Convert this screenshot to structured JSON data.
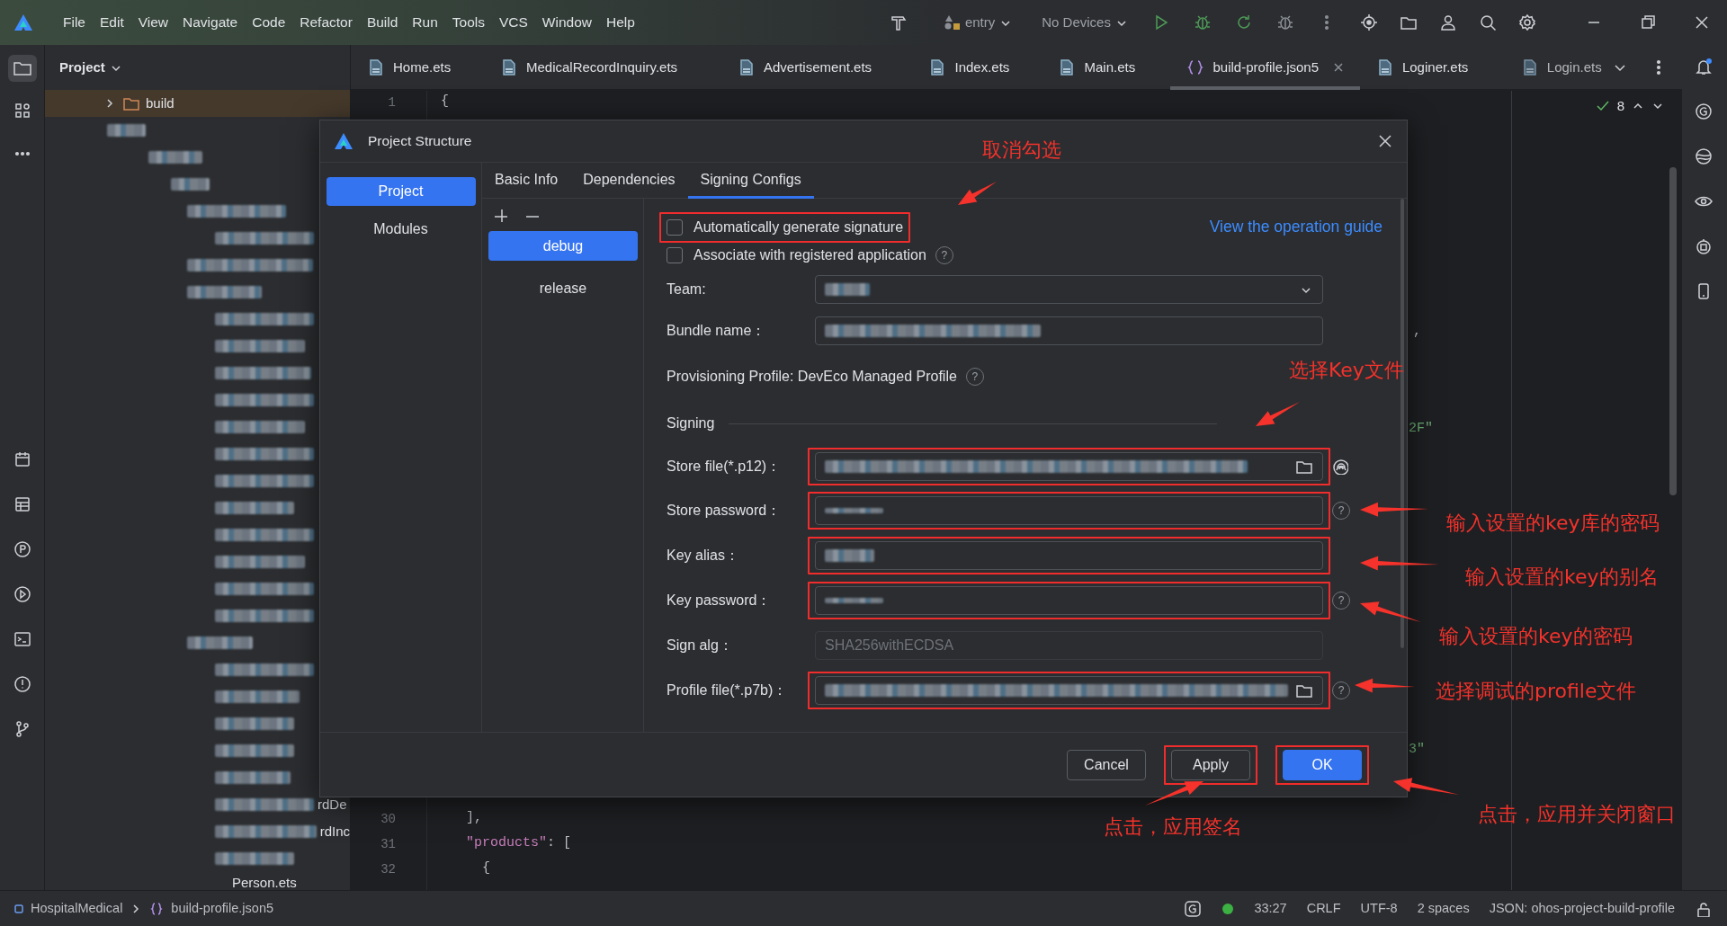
{
  "menu": [
    "File",
    "Edit",
    "View",
    "Navigate",
    "Code",
    "Refactor",
    "Build",
    "Run",
    "Tools",
    "VCS",
    "Window",
    "Help"
  ],
  "toolbar": {
    "run_config": "entry",
    "device": "No Devices"
  },
  "project_panel": {
    "title": "Project",
    "root": "build",
    "fragments": [
      "rdDe",
      "rdInc"
    ],
    "last_item": "Person.ets"
  },
  "editor_tabs": [
    {
      "label": "Home.ets",
      "kind": "ets",
      "selected": false
    },
    {
      "label": "MedicalRecordInquiry.ets",
      "kind": "ets",
      "selected": false
    },
    {
      "label": "Advertisement.ets",
      "kind": "ets",
      "selected": false
    },
    {
      "label": "Index.ets",
      "kind": "ets",
      "selected": false
    },
    {
      "label": "Main.ets",
      "kind": "ets",
      "selected": false
    },
    {
      "label": "build-profile.json5",
      "kind": "json",
      "selected": true
    },
    {
      "label": "Loginer.ets",
      "kind": "ets",
      "selected": false
    },
    {
      "label": "Login.ets",
      "kind": "ets",
      "selected": false
    }
  ],
  "inspections": {
    "count": "8"
  },
  "code_lines": [
    {
      "number": "1",
      "tokens": [
        {
          "text": "{",
          "kind": "punct"
        }
      ]
    },
    {
      "number": "30",
      "tokens": [
        {
          "text": "],",
          "kind": "punct"
        }
      ]
    },
    {
      "number": "31",
      "tokens": [
        {
          "text": "\"products\"",
          "kind": "key"
        },
        {
          "text": ": [",
          "kind": "punct"
        }
      ]
    },
    {
      "number": "32",
      "tokens": [
        {
          "text": "{",
          "kind": "punct"
        }
      ]
    }
  ],
  "code_fragments": [
    ",",
    "2F\"",
    "3\""
  ],
  "dialog": {
    "title": "Project Structure",
    "nav": [
      {
        "label": "Project",
        "selected": true
      },
      {
        "label": "Modules",
        "selected": false
      }
    ],
    "tabs": [
      {
        "label": "Basic Info",
        "selected": false
      },
      {
        "label": "Dependencies",
        "selected": false
      },
      {
        "label": "Signing Configs",
        "selected": true
      }
    ],
    "configs": [
      {
        "label": "debug",
        "selected": true
      },
      {
        "label": "release",
        "selected": false
      }
    ],
    "options": [
      {
        "label": "Automatically generate signature",
        "checked": false,
        "highlighted": true
      },
      {
        "label": "Associate with registered application",
        "checked": false,
        "highlighted": false,
        "help": "?"
      }
    ],
    "guide_link": "View the operation guide",
    "fields": [
      {
        "kind": "select",
        "label": "Team:",
        "blurred": true,
        "highlighted": false
      },
      {
        "kind": "text",
        "label": "Bundle name：",
        "blurred": true,
        "highlighted": false
      },
      {
        "kind": "info",
        "label": "Provisioning Profile: DevEco Managed Profile",
        "help": "?"
      },
      {
        "kind": "section",
        "label": "Signing"
      },
      {
        "kind": "keystore",
        "label": "Store file(*.p12)：",
        "blurred": true,
        "highlighted": true
      },
      {
        "kind": "password",
        "label": "Store password：",
        "blurred": true,
        "highlighted": true,
        "help": "?"
      },
      {
        "kind": "text",
        "label": "Key alias：",
        "blurred": true,
        "highlighted": true
      },
      {
        "kind": "password",
        "label": "Key password：",
        "blurred": true,
        "highlighted": true,
        "help": "?"
      },
      {
        "kind": "readonly",
        "label": "Sign alg：",
        "value": "SHA256withECDSA",
        "highlighted": false
      },
      {
        "kind": "file",
        "label": "Profile file(*.p7b)：",
        "blurred": true,
        "highlighted": true,
        "help": "?"
      }
    ],
    "buttons": [
      {
        "label": "Cancel",
        "kind": "secondary",
        "highlighted": false
      },
      {
        "label": "Apply",
        "kind": "secondary",
        "highlighted": true
      },
      {
        "label": "OK",
        "kind": "primary",
        "highlighted": true
      }
    ]
  },
  "annotations": [
    "取消勾选",
    "选择Key文件",
    "输入设置的key库的密码",
    "输入设置的key的别名",
    "输入设置的key的密码",
    "选择调试的profile文件",
    "点击，应用签名",
    "点击，应用并关闭窗口"
  ],
  "status_bar": {
    "project": "HospitalMedical",
    "file": "build-profile.json5",
    "items": [
      "33:27",
      "CRLF",
      "UTF-8",
      "2 spaces",
      "JSON: ohos-project-build-profile"
    ]
  }
}
